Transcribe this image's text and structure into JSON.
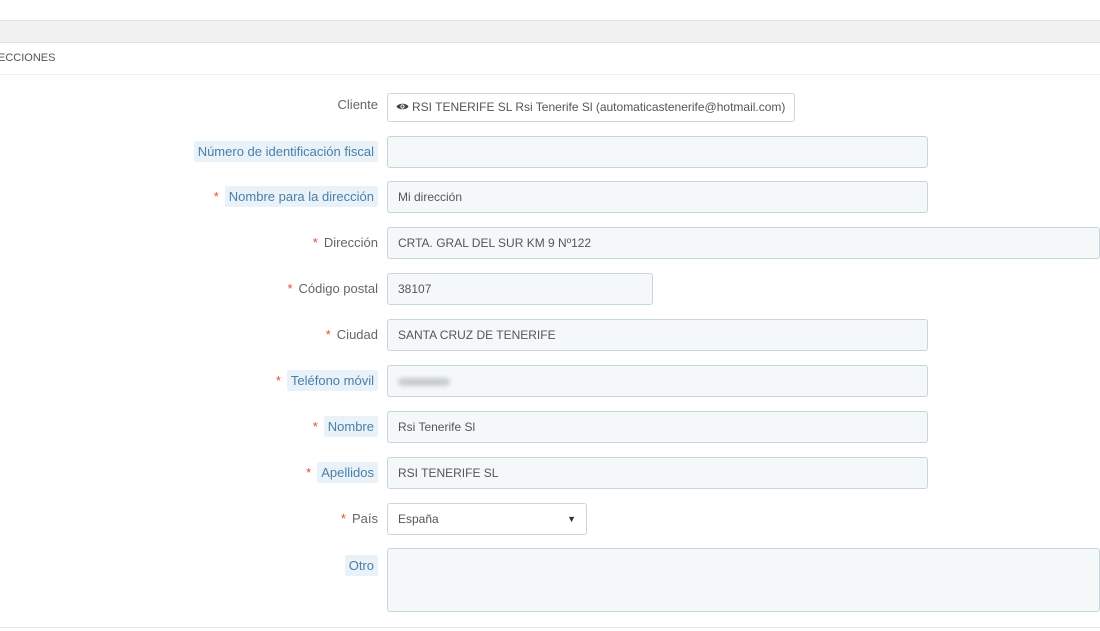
{
  "panel": {
    "title": "ECCIONES"
  },
  "form": {
    "cliente": {
      "label": "Cliente",
      "value": "RSI TENERIFE SL Rsi Tenerife Sl (automaticastenerife@hotmail.com)"
    },
    "nif": {
      "label": "Número de identificación fiscal",
      "value": ""
    },
    "alias": {
      "label": "Nombre para la dirección",
      "value": "Mi dirección",
      "required": "*"
    },
    "direccion": {
      "label": "Dirección",
      "value": "CRTA. GRAL DEL SUR KM 9 Nº122",
      "required": "*"
    },
    "cp": {
      "label": "Código postal",
      "value": "38107",
      "required": "*"
    },
    "ciudad": {
      "label": "Ciudad",
      "value": "SANTA CRUZ DE TENERIFE",
      "required": "*"
    },
    "movil": {
      "label": "Teléfono móvil",
      "required": "*"
    },
    "nombre": {
      "label": "Nombre",
      "value": "Rsi Tenerife Sl",
      "required": "*"
    },
    "apellidos": {
      "label": "Apellidos",
      "value": "RSI TENERIFE SL",
      "required": "*"
    },
    "pais": {
      "label": "País",
      "value": "España",
      "required": "*",
      "arrow": "▼"
    },
    "otro": {
      "label": "Otro",
      "value": ""
    }
  },
  "icons": {
    "client_icon": "eye-icon",
    "select_icon": "caret-down-icon"
  }
}
